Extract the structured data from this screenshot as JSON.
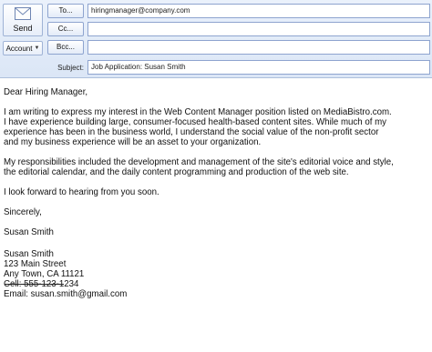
{
  "toolbar": {
    "send_label": "Send",
    "account_label": "Account"
  },
  "fields": {
    "to_label": "To...",
    "to_value": "hiringmanager@company.com",
    "cc_label": "Cc...",
    "cc_value": "",
    "bcc_label": "Bcc...",
    "bcc_value": "",
    "subject_label": "Subject:",
    "subject_value": "Job Application: Susan Smith"
  },
  "letter": {
    "greeting": "Dear Hiring Manager,",
    "p1_lines": [
      "I am writing to express my interest in the Web Content Manager position listed on MediaBistro.com.",
      "I have experience building large, consumer-focused health-based content sites. While much of my",
      "experience has been in the business world, I understand the social value of the non-profit sector",
      "and my business experience will be an asset to your organization."
    ],
    "p2_lines": [
      "My responsibilities included the development and management of the site's editorial voice and style,",
      "the editorial calendar, and the daily content programming and production of the web site."
    ],
    "p3": "I look forward to hearing from you soon.",
    "closing": "Sincerely,",
    "signature_name": "Susan Smith",
    "contact": {
      "name": "Susan Smith",
      "street": "123 Main Street",
      "city": "Any Town, CA  11121",
      "cell": "Cell:  555-123-1234",
      "email": "Email:  susan.smith@gmail.com"
    }
  },
  "icons": {
    "send": "envelope-icon",
    "account_caret": "chevron-down-icon"
  }
}
